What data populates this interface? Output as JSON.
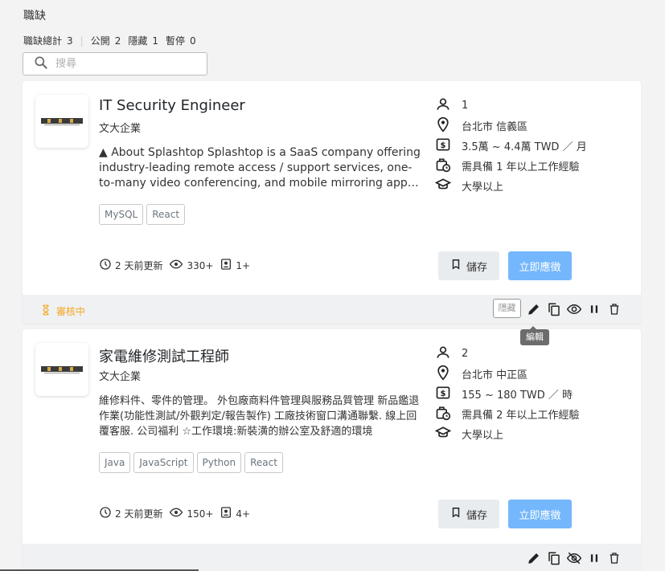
{
  "header": {
    "title": "職缺",
    "summary": {
      "total_label": "職缺總計",
      "total": "3",
      "public_label": "公開",
      "public": "2",
      "hidden_label": "隱藏",
      "hidden": "1",
      "paused_label": "暫停",
      "paused": "0"
    },
    "search_placeholder": "搜尋"
  },
  "jobs": [
    {
      "title": "IT Security Engineer",
      "company": "文大企業",
      "description": "▲ About Splashtop Splashtop is a SaaS company offering industry-leading remote access / support services, one-to-many video conferencing, and mobile mirroring apps. Our solutions help businesses and individuals work from anywhere.",
      "tags": [
        "MySQL",
        "React"
      ],
      "headcount": "1",
      "location": "台北市 信義區",
      "salary": "3.5萬 ~ 4.4萬 TWD ／ 月",
      "experience": "需具備 1 年以上工作經驗",
      "education": "大學以上",
      "updated": "2 天前更新",
      "views": "330+",
      "applicants": "1+",
      "save_label": "儲存",
      "apply_label": "立即應徵",
      "status": "審核中",
      "hidden_badge": "隱藏"
    },
    {
      "title": "家電維修測試工程師",
      "company": "文大企業",
      "description": "維修料件、零件的管理。 外包廠商料件管理與服務品質管理 新品鑑退作業(功能性測試/外觀判定/報告製作) 工廠技術窗口溝通聯繫. 線上回覆客服. 公司福利 ☆工作環境:新裝潢的辦公室及舒適的環境",
      "tags": [
        "Java",
        "JavaScript",
        "Python",
        "React"
      ],
      "headcount": "2",
      "location": "台北市 中正區",
      "salary": "155 ~ 180 TWD ／ 時",
      "experience": "需具備 2 年以上工作經驗",
      "education": "大學以上",
      "updated": "2 天前更新",
      "views": "150+",
      "applicants": "4+",
      "save_label": "儲存",
      "apply_label": "立即應徵"
    }
  ],
  "tooltip": "編輯",
  "colors": {
    "accent": "#74b7fc",
    "pending": "#f5a623"
  }
}
